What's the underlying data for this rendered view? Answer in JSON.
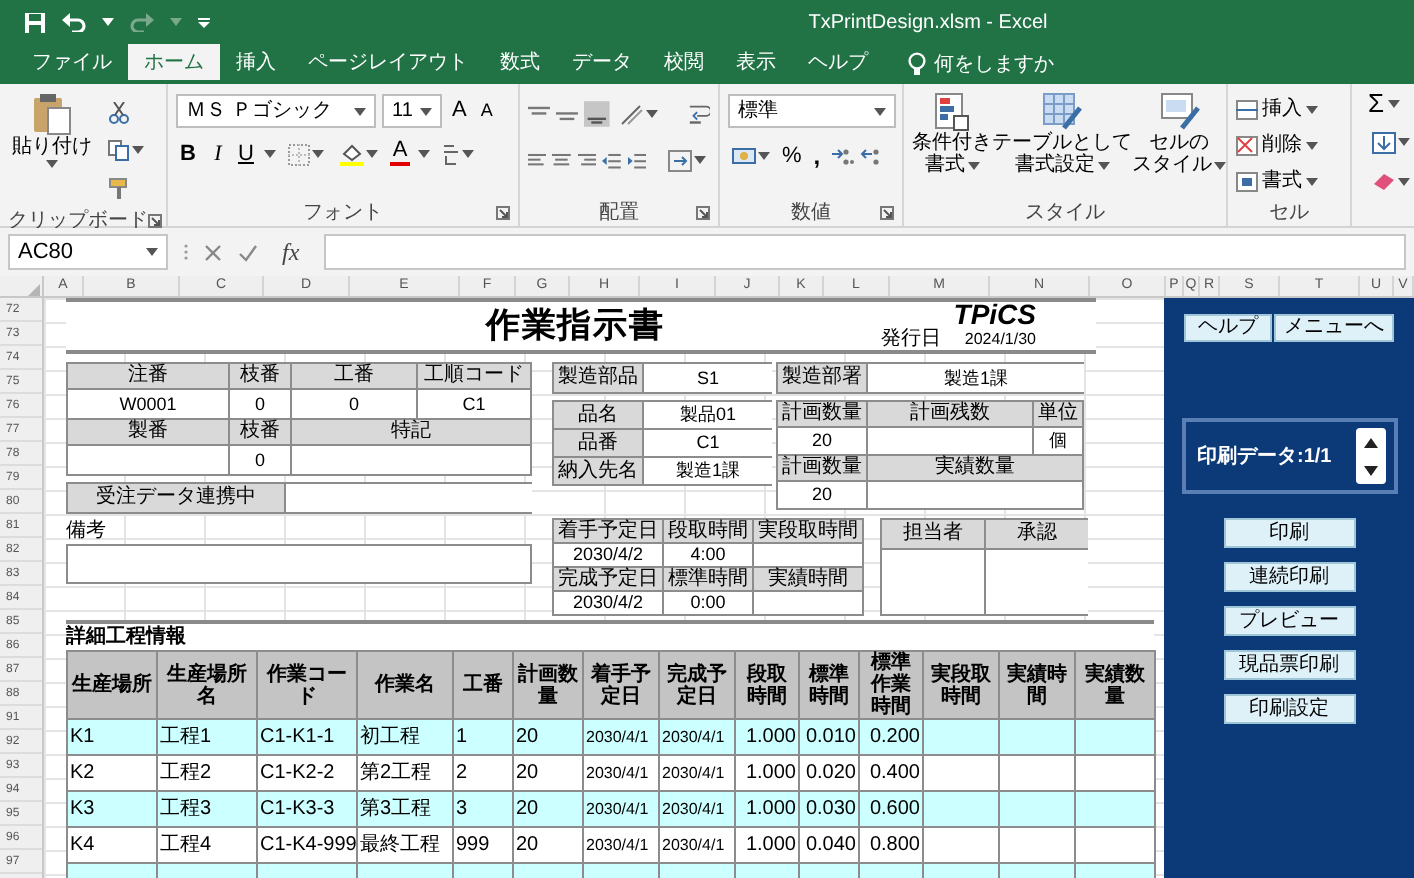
{
  "window": {
    "title": "TxPrintDesign.xlsm - Excel"
  },
  "ribbon_tabs": [
    {
      "label": "ファイル",
      "selected": false
    },
    {
      "label": "ホーム",
      "selected": true
    },
    {
      "label": "挿入",
      "selected": false
    },
    {
      "label": "ページレイアウト",
      "selected": false
    },
    {
      "label": "数式",
      "selected": false
    },
    {
      "label": "データ",
      "selected": false
    },
    {
      "label": "校閲",
      "selected": false
    },
    {
      "label": "表示",
      "selected": false
    },
    {
      "label": "ヘルプ",
      "selected": false
    }
  ],
  "tell_me": "何をしますか",
  "ribbon": {
    "paste": "貼り付け",
    "font_name": "ＭＳ Ｐゴシック",
    "font_size": "11",
    "grow_font": "A",
    "shrink_font": "A",
    "bold": "B",
    "italic": "I",
    "underline": "U",
    "font_color": "A",
    "number_format": "標準",
    "percent": "%",
    "comma": ",",
    "conditional_format": [
      "条件付き",
      "書式"
    ],
    "format_as_table": [
      "テーブルとして",
      "書式設定"
    ],
    "cell_styles": [
      "セルの",
      "スタイル"
    ],
    "insert": "挿入",
    "delete": "削除",
    "format": "書式",
    "autosum": "Σ",
    "groups": [
      "クリップボード",
      "フォント",
      "配置",
      "数値",
      "スタイル",
      "セル"
    ]
  },
  "formula_bar": {
    "name_box": "AC80",
    "fx": "fx"
  },
  "column_headers": [
    "A",
    "B",
    "C",
    "D",
    "E",
    "F",
    "G",
    "H",
    "I",
    "J",
    "K",
    "L",
    "M",
    "N",
    "O",
    "P",
    "Q",
    "R",
    "S",
    "T",
    "U",
    "V"
  ],
  "row_numbers": [
    "72",
    "73",
    "74",
    "75",
    "76",
    "77",
    "78",
    "79",
    "80",
    "81",
    "82",
    "83",
    "84",
    "85",
    "86",
    "87",
    "88",
    "91",
    "92",
    "93",
    "94",
    "95",
    "96",
    "97"
  ],
  "form": {
    "title": "作業指示書",
    "logo": "TPiCS",
    "issue_date_label": "発行日",
    "issue_date": "2024/1/30",
    "order_fields": [
      {
        "label": "注番",
        "value": "W0001"
      },
      {
        "label": "枝番",
        "value": "0"
      },
      {
        "label": "工番",
        "value": "0"
      },
      {
        "label": "工順コード",
        "value": "C1"
      },
      {
        "label": "製番"
      },
      {
        "label": "枝番",
        "value": "0"
      },
      {
        "label": "特記"
      }
    ],
    "link_status": {
      "label": "受注データ連携中"
    },
    "remarks_label": "備考",
    "part": {
      "label": "製造部品",
      "value": "S1"
    },
    "product_fields": [
      {
        "label": "品名",
        "value": "製品01"
      },
      {
        "label": "品番",
        "value": "C1"
      },
      {
        "label": "納入先名",
        "value": "製造1課"
      }
    ],
    "department": {
      "label": "製造部署",
      "value": "製造1課"
    },
    "quantity_fields": [
      {
        "label": "計画数量",
        "value": "20"
      },
      {
        "label": "計画残数"
      },
      {
        "label": "単位",
        "value": "個"
      },
      {
        "label": "計画数量",
        "value": "20"
      },
      {
        "label": "実績数量"
      }
    ],
    "schedule_fields": [
      {
        "label": "着手予定日",
        "value": "2030/4/2"
      },
      {
        "label": "段取時間",
        "value": "4:00"
      },
      {
        "label": "実段取時間"
      },
      {
        "label": "完成予定日",
        "value": "2030/4/2"
      },
      {
        "label": "標準時間",
        "value": "0:00"
      },
      {
        "label": "実績時間"
      }
    ],
    "approval_fields": [
      {
        "label": "担当者"
      },
      {
        "label": "承認"
      }
    ]
  },
  "detail": {
    "title": "詳細工程情報",
    "columns": [
      "生産場所",
      "生産場所名",
      "作業コード",
      "作業名",
      "工番",
      "計画数量",
      "着手予定日",
      "完成予定日",
      "段取時間",
      "標準時間",
      "標準作業時間",
      "実段取時間",
      "実績時間",
      "実績数量"
    ],
    "rows": [
      {
        "shaded": true,
        "cells": [
          "K1",
          "工程1",
          "C1-K1-1",
          "初工程",
          "1",
          "20",
          "2030/4/1",
          "2030/4/1",
          "1.000",
          "0.010",
          "0.200"
        ]
      },
      {
        "shaded": false,
        "cells": [
          "K2",
          "工程2",
          "C1-K2-2",
          "第2工程",
          "2",
          "20",
          "2030/4/1",
          "2030/4/1",
          "1.000",
          "0.020",
          "0.400"
        ]
      },
      {
        "shaded": true,
        "cells": [
          "K3",
          "工程3",
          "C1-K3-3",
          "第3工程",
          "3",
          "20",
          "2030/4/1",
          "2030/4/1",
          "1.000",
          "0.030",
          "0.600"
        ]
      },
      {
        "shaded": false,
        "cells": [
          "K4",
          "工程4",
          "C1-K4-999",
          "最終工程",
          "999",
          "20",
          "2030/4/1",
          "2030/4/1",
          "1.000",
          "0.040",
          "0.800"
        ]
      },
      {
        "shaded": true
      }
    ]
  },
  "side_panel": {
    "help": "ヘルプ",
    "menu": "メニューへ",
    "print_data": "印刷データ:1/1",
    "actions": [
      "印刷",
      "連続印刷",
      "プレビュー",
      "現品票印刷",
      "印刷設定"
    ]
  }
}
